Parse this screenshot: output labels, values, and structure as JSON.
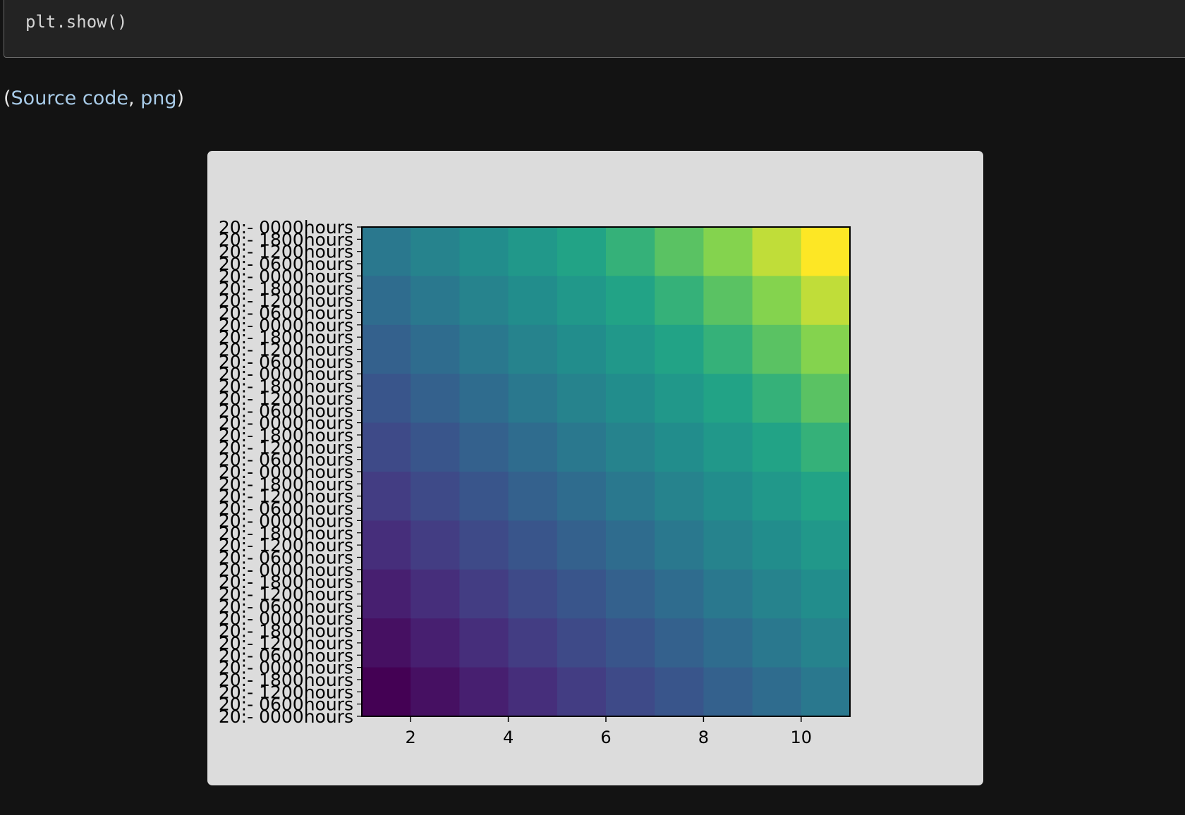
{
  "code": {
    "line": "plt.show()"
  },
  "source": {
    "open": "(",
    "source_code_label": "Source code",
    "sep": ", ",
    "png_label": "png",
    "close": ")"
  },
  "chart_data": {
    "type": "heatmap",
    "colormap": "viridis",
    "x_ticks": [
      2,
      4,
      6,
      8,
      10
    ],
    "xlim": [
      1,
      11
    ],
    "grid": false,
    "y_tick_labels": [
      "20:- 0000hours",
      "20:- 0600hours",
      "20:- 1200hours",
      "20:- 1800hours",
      "20:- 0000hours",
      "20:- 0600hours",
      "20:- 1200hours",
      "20:- 1800hours",
      "20:- 0000hours",
      "20:- 0600hours",
      "20:- 1200hours",
      "20:- 1800hours",
      "20:- 0000hours",
      "20:- 0600hours",
      "20:- 1200hours",
      "20:- 1800hours",
      "20:- 0000hours",
      "20:- 0600hours",
      "20:- 1200hours",
      "20:- 1800hours",
      "20:- 0000hours",
      "20:- 0600hours",
      "20:- 1200hours",
      "20:- 1800hours",
      "20:- 0000hours",
      "20:- 0600hours",
      "20:- 1200hours",
      "20:- 1800hours",
      "20:- 0000hours",
      "20:- 0600hours",
      "20:- 1200hours",
      "20:- 1800hours",
      "20:- 0000hours",
      "20:- 0600hours",
      "20:- 1200hours",
      "20:- 1800hours",
      "20:- 0000hours",
      "20:- 0600hours",
      "20:- 1200hours",
      "20:- 1800hours",
      "20:- 0000hours"
    ],
    "values_top_to_bottom": [
      [
        9,
        10,
        11,
        12,
        13,
        14,
        15,
        16,
        17,
        18
      ],
      [
        8,
        9,
        10,
        11,
        12,
        13,
        14,
        15,
        16,
        17
      ],
      [
        7,
        8,
        9,
        10,
        11,
        12,
        13,
        14,
        15,
        16
      ],
      [
        6,
        7,
        8,
        9,
        10,
        11,
        12,
        13,
        14,
        15
      ],
      [
        5,
        6,
        7,
        8,
        9,
        10,
        11,
        12,
        13,
        14
      ],
      [
        4,
        5,
        6,
        7,
        8,
        9,
        10,
        11,
        12,
        13
      ],
      [
        3,
        4,
        5,
        6,
        7,
        8,
        9,
        10,
        11,
        12
      ],
      [
        2,
        3,
        4,
        5,
        6,
        7,
        8,
        9,
        10,
        11
      ],
      [
        1,
        2,
        3,
        4,
        5,
        6,
        7,
        8,
        9,
        10
      ],
      [
        0,
        1,
        2,
        3,
        4,
        5,
        6,
        7,
        8,
        9
      ]
    ],
    "value_range": [
      0,
      18
    ]
  }
}
